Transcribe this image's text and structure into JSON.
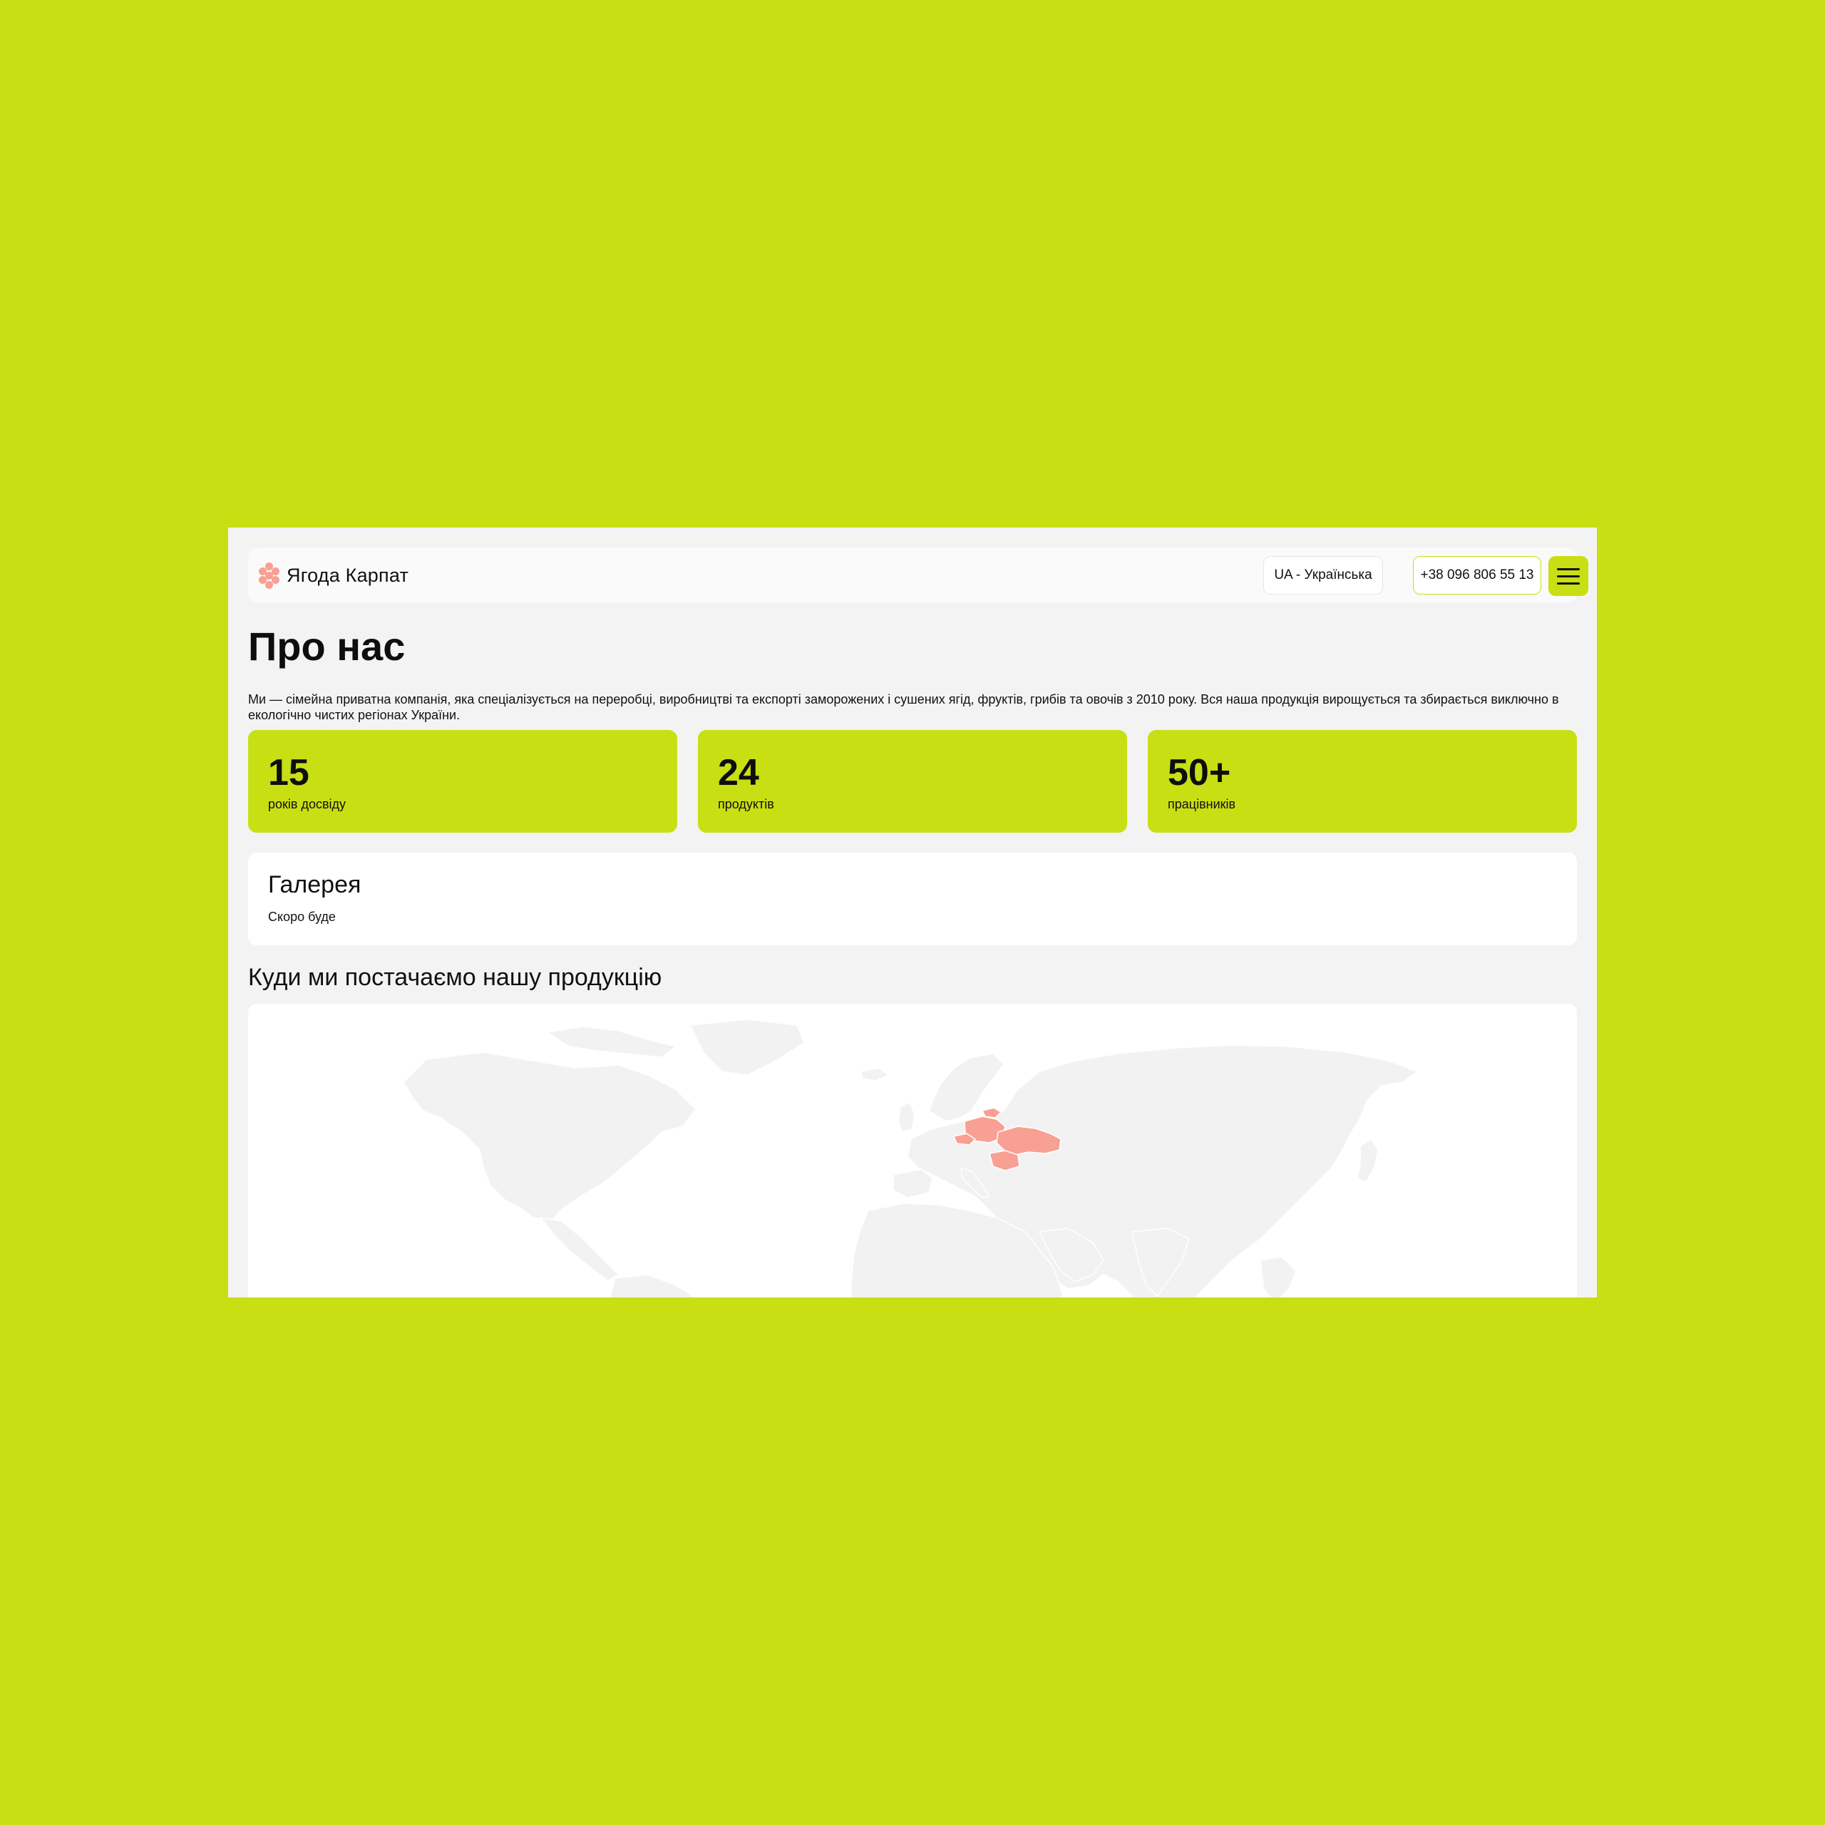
{
  "header": {
    "brand": "Ягода Карпат",
    "language_label": "UA - Українська",
    "phone": "+38 096 806 55 13"
  },
  "about": {
    "title": "Про нас",
    "intro": "Ми — сімейна приватна компанія, яка спеціалізується на переробці, виробництві та експорті заморожених і сушених ягід, фруктів, грибів та овочів з 2010 року. Вся наша продукція вирощується та збирається виключно в екологічно чистих регіонах України."
  },
  "stats": [
    {
      "value": "15",
      "label": "років досвіду"
    },
    {
      "value": "24",
      "label": "продуктів"
    },
    {
      "value": "50+",
      "label": "працівників"
    }
  ],
  "gallery": {
    "title": "Галерея",
    "subtitle": "Скоро буде"
  },
  "map": {
    "title": "Куди ми постачаємо нашу продукцію"
  },
  "colors": {
    "accent": "#c8df13",
    "page_background": "#f3f3f3",
    "card_background": "#ffffff",
    "highlight_countries": "#f8a093",
    "land": "#f2f2f2"
  },
  "icons": {
    "logo": "berry-logo-icon",
    "menu": "hamburger-menu-icon"
  }
}
